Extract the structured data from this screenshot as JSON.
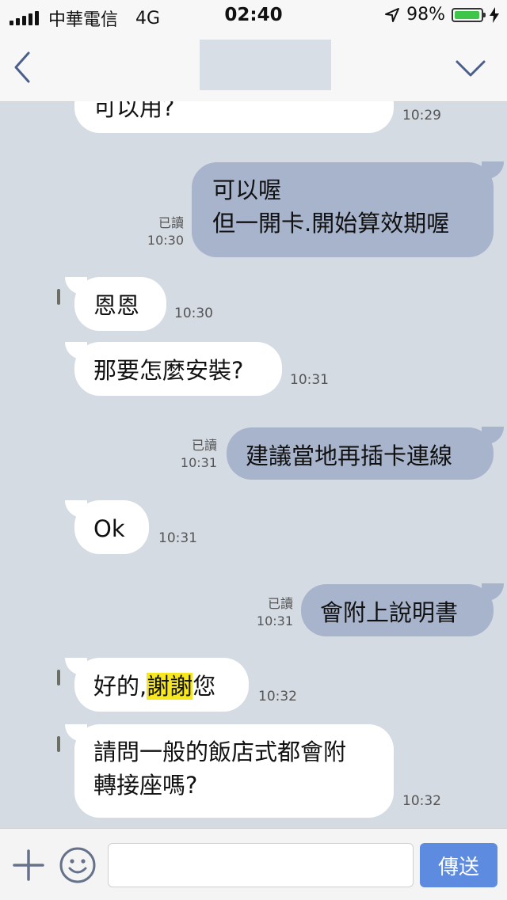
{
  "status_bar": {
    "carrier": "中華電信",
    "network": "4G",
    "time": "02:40",
    "battery": "98%",
    "battery_level": 0.98
  },
  "header": {
    "back_icon": "chevron-left-icon",
    "menu_icon": "chevron-down-icon"
  },
  "messages": [
    {
      "dir": "in",
      "text": "可以用?",
      "time": "10:29"
    },
    {
      "dir": "out",
      "lines": [
        "可以喔",
        "但一開卡.開始算效期喔"
      ],
      "read": "已讀",
      "time": "10:30"
    },
    {
      "dir": "in",
      "text": "恩恩",
      "time": "10:30"
    },
    {
      "dir": "in",
      "text": "那要怎麼安裝?",
      "time": "10:31"
    },
    {
      "dir": "out",
      "text": "建議當地再插卡連線",
      "read": "已讀",
      "time": "10:31"
    },
    {
      "dir": "in",
      "text": "Ok",
      "time": "10:31"
    },
    {
      "dir": "out",
      "text": "會附上說明書",
      "read": "已讀",
      "time": "10:31"
    },
    {
      "dir": "in",
      "text_before": "好的,",
      "text_highlight": "謝謝",
      "text_after": "您",
      "time": "10:32"
    },
    {
      "dir": "in",
      "lines": [
        "請問一般的飯店式都會附",
        "轉接座嗎?"
      ],
      "time": "10:32"
    }
  ],
  "input_bar": {
    "plus_icon": "plus-icon",
    "emoji_icon": "emoji-icon",
    "placeholder": "",
    "send_label": "傳送"
  },
  "colors": {
    "chat_bg": "#d5dbe3",
    "incoming_bubble": "#ffffff",
    "outgoing_bubble": "#a7b4cc",
    "send_button": "#5d8be0",
    "highlight": "#f6e71e"
  }
}
